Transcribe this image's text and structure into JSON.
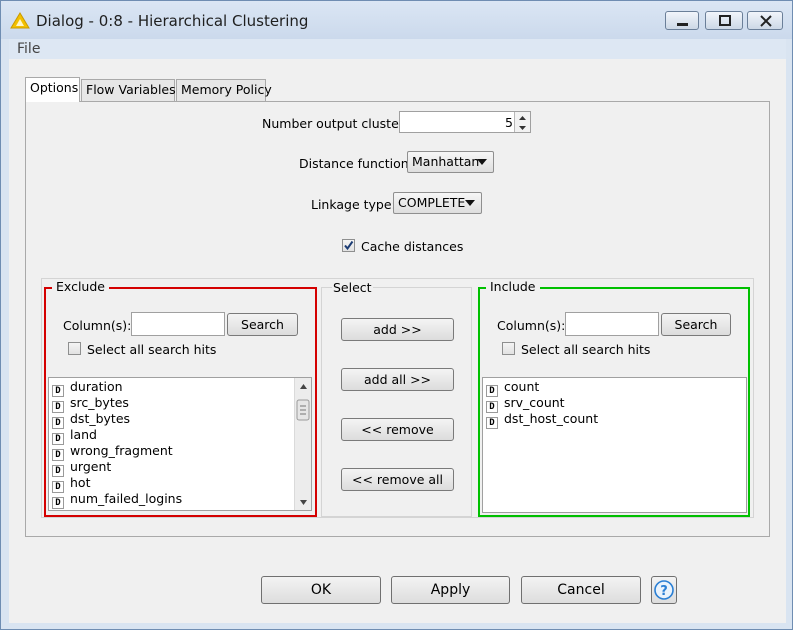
{
  "window": {
    "title": "Dialog - 0:8 - Hierarchical Clustering",
    "menu_file": "File"
  },
  "tabs": [
    {
      "label": "Options",
      "active": true
    },
    {
      "label": "Flow Variables",
      "active": false
    },
    {
      "label": "Memory Policy",
      "active": false
    }
  ],
  "options": {
    "number_output_cluster_label": "Number output cluster:",
    "number_output_cluster_value": "5",
    "distance_function_label": "Distance function:",
    "distance_function_value": "Manhattan",
    "linkage_type_label": "Linkage type:",
    "linkage_type_value": "COMPLETE",
    "cache_distances_label": "Cache distances",
    "cache_distances_checked": true
  },
  "exclude": {
    "legend": "Exclude",
    "columns_label": "Column(s):",
    "search_value": "",
    "search_button": "Search",
    "select_all_label": "Select all search hits",
    "items": [
      "duration",
      "src_bytes",
      "dst_bytes",
      "land",
      "wrong_fragment",
      "urgent",
      "hot",
      "num_failed_logins"
    ]
  },
  "select": {
    "legend": "Select",
    "add": "add >>",
    "add_all": "add all >>",
    "remove": "<< remove",
    "remove_all": "<< remove all"
  },
  "include": {
    "legend": "Include",
    "columns_label": "Column(s):",
    "search_value": "",
    "search_button": "Search",
    "select_all_label": "Select all search hits",
    "items": [
      "count",
      "srv_count",
      "dst_host_count"
    ]
  },
  "footer": {
    "ok": "OK",
    "apply": "Apply",
    "cancel": "Cancel",
    "help_icon": "help-icon"
  },
  "colors": {
    "exclude_border": "#d40000",
    "include_border": "#00c000",
    "help_accent": "#2a7fd4",
    "app_icon": "#f3c000"
  }
}
